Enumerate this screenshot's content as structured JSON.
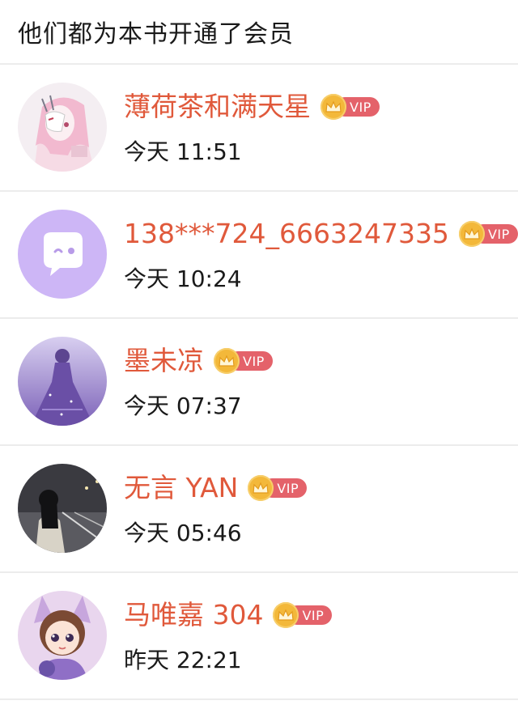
{
  "header": {
    "title": "他们都为本书开通了会员"
  },
  "vip_badge_label": "VIP",
  "colors": {
    "name": "#e0593b",
    "vip_pill": "#e4626a",
    "vip_crown": "#f3b83a",
    "divider": "#ececec"
  },
  "members": [
    {
      "name": "薄荷茶和满天星",
      "time": "今天 11:51",
      "avatar": "anime-mask-girl-avatar"
    },
    {
      "name": "138***724_6663247335",
      "time": "今天 10:24",
      "avatar": "default-chat-bubble-avatar"
    },
    {
      "name": "墨未凉",
      "time": "今天 07:37",
      "avatar": "purple-dress-avatar"
    },
    {
      "name": "无言 YAN",
      "time": "今天 05:46",
      "avatar": "night-street-avatar"
    },
    {
      "name": "马唯嘉 304",
      "time": "昨天 22:21",
      "avatar": "cartoon-girl-avatar"
    }
  ]
}
